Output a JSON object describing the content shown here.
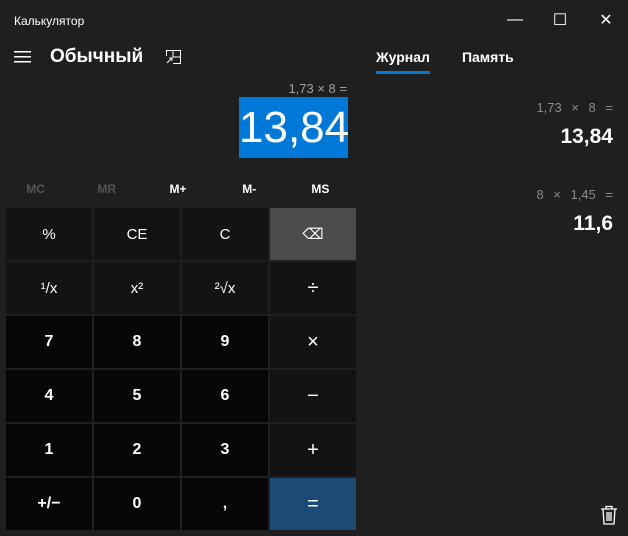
{
  "window": {
    "title": "Калькулятор",
    "minimize": "—",
    "maximize": "☐",
    "close": "✕"
  },
  "header": {
    "mode": "Обычный"
  },
  "display": {
    "expression": "1,73 × 8 =",
    "result": "13,84"
  },
  "memory": [
    "MC",
    "MR",
    "M+",
    "M-",
    "MS"
  ],
  "keys": [
    {
      "label": "%",
      "type": "f",
      "name": "percent"
    },
    {
      "label": "CE",
      "type": "f",
      "name": "clear-entry"
    },
    {
      "label": "C",
      "type": "f",
      "name": "clear"
    },
    {
      "label": "⌫",
      "type": "bs",
      "name": "backspace"
    },
    {
      "label": "¹/x",
      "type": "f",
      "name": "reciprocal"
    },
    {
      "label": "x²",
      "type": "f",
      "name": "square"
    },
    {
      "label": "²√x",
      "type": "f",
      "name": "square-root"
    },
    {
      "label": "÷",
      "type": "op",
      "name": "divide"
    },
    {
      "label": "7",
      "type": "d",
      "name": "7"
    },
    {
      "label": "8",
      "type": "d",
      "name": "8"
    },
    {
      "label": "9",
      "type": "d",
      "name": "9"
    },
    {
      "label": "×",
      "type": "op",
      "name": "multiply"
    },
    {
      "label": "4",
      "type": "d",
      "name": "4"
    },
    {
      "label": "5",
      "type": "d",
      "name": "5"
    },
    {
      "label": "6",
      "type": "d",
      "name": "6"
    },
    {
      "label": "−",
      "type": "op",
      "name": "minus"
    },
    {
      "label": "1",
      "type": "d",
      "name": "1"
    },
    {
      "label": "2",
      "type": "d",
      "name": "2"
    },
    {
      "label": "3",
      "type": "d",
      "name": "3"
    },
    {
      "label": "+",
      "type": "op",
      "name": "plus"
    },
    {
      "label": "+/−",
      "type": "d",
      "name": "negate"
    },
    {
      "label": "0",
      "type": "d",
      "name": "0"
    },
    {
      "label": ",",
      "type": "d",
      "name": "decimal"
    },
    {
      "label": "=",
      "type": "eq",
      "name": "equals"
    }
  ],
  "tabs": {
    "history": "Журнал",
    "memory": "Память"
  },
  "history": [
    {
      "expression": "1,73 × 8 =",
      "result": "13,84"
    },
    {
      "expression": "8 × 1,45 =",
      "result": "11,6"
    }
  ]
}
